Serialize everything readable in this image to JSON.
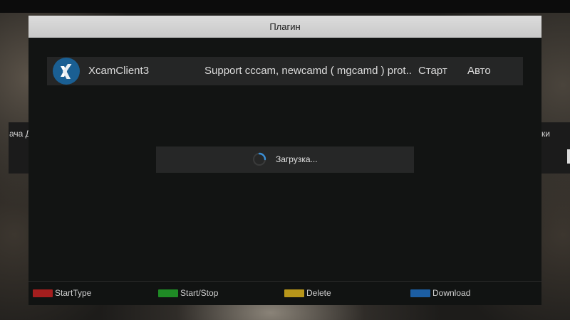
{
  "background": {
    "left_fragment": "ача Д",
    "right_fragment": "ки"
  },
  "window": {
    "title": "Плагин"
  },
  "plugin": {
    "icon": "xing-logo-icon",
    "name": "XcamClient3",
    "description": "Support cccam, newcamd ( mgcamd ) prot..",
    "status": "Старт",
    "mode": "Авто"
  },
  "loading": {
    "icon": "spinner-icon",
    "text": "Загрузка..."
  },
  "footer": {
    "keys": [
      {
        "color": "#a51e1e",
        "label": "StartType"
      },
      {
        "color": "#1f8a25",
        "label": "Start/Stop"
      },
      {
        "color": "#b8961a",
        "label": "Delete"
      },
      {
        "color": "#1c5ea3",
        "label": "Download"
      }
    ]
  },
  "colors": {
    "window_bg": "#121413",
    "title_bg": "#d4d4d4",
    "row_bg": "#252626",
    "icon_bg": "#1a5f93",
    "spinner": "#3a8fd6"
  }
}
